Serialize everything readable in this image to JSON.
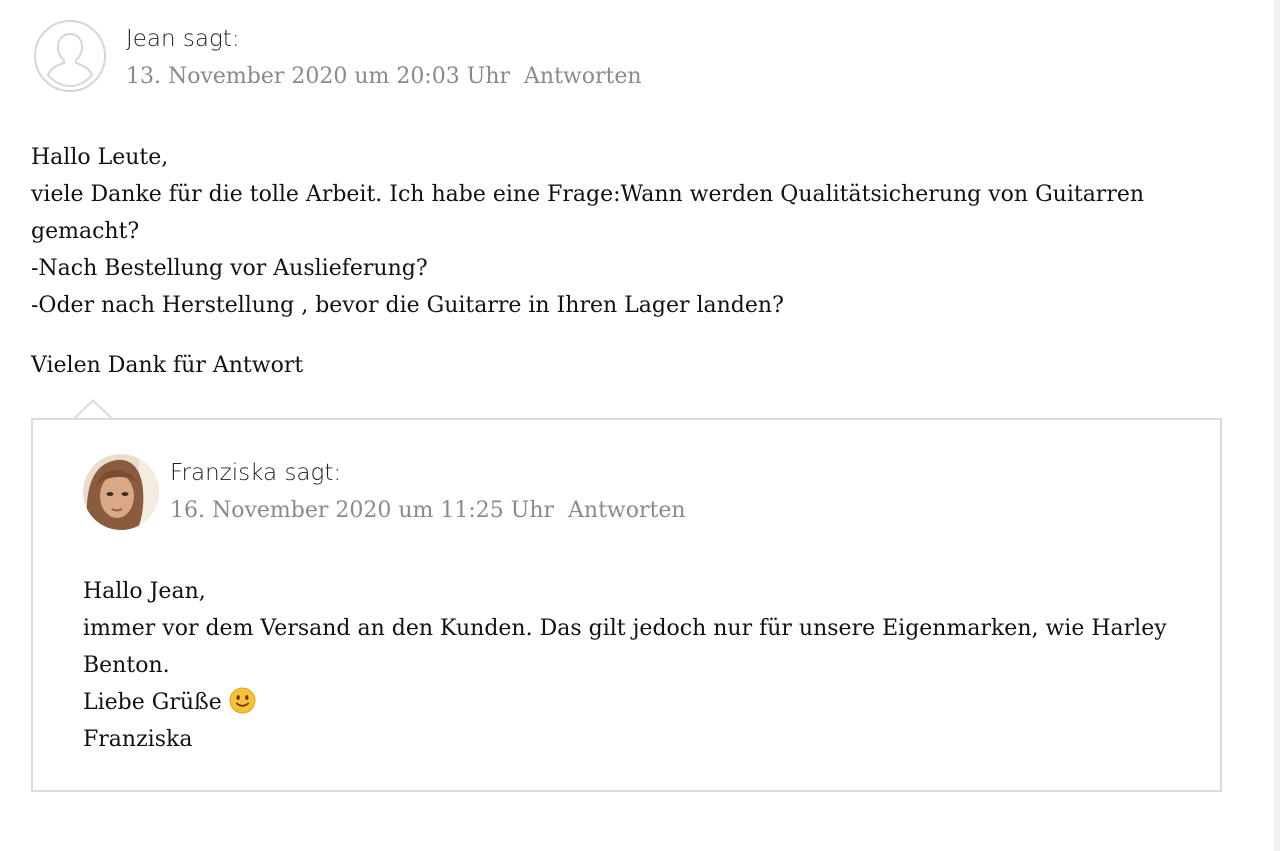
{
  "comment": {
    "author": "Jean sagt:",
    "date": "13. November 2020 um 20:03 Uhr",
    "reply_link": "Antworten",
    "body_lines": [
      "Hallo Leute,",
      "viele Danke für die tolle Arbeit. Ich habe eine Frage:Wann werden Qualitätsicherung von Guitarren gemacht?",
      "-Nach Bestellung vor Auslieferung?",
      "-Oder nach Herstellung , bevor die Guitarre in Ihren Lager landen?"
    ],
    "closing": "Vielen Dank für Antwort"
  },
  "reply": {
    "author": "Franziska sagt:",
    "date": "16. November 2020 um 11:25 Uhr",
    "reply_link": "Antworten",
    "greeting": "Hallo Jean,",
    "body": "immer vor dem Versand an den Kunden. Das gilt jedoch nur für unsere Eigenmarken, wie Harley Benton.",
    "regards": "Liebe Grüße",
    "signature": "Franziska"
  },
  "icons": {
    "default_avatar": "user-silhouette-icon",
    "smiley": "slightly-smiling-face-icon"
  },
  "colors": {
    "meta_text": "#8a8a8a",
    "box_border": "#dcdcdc",
    "emoji_yellow": "#f8c136"
  }
}
